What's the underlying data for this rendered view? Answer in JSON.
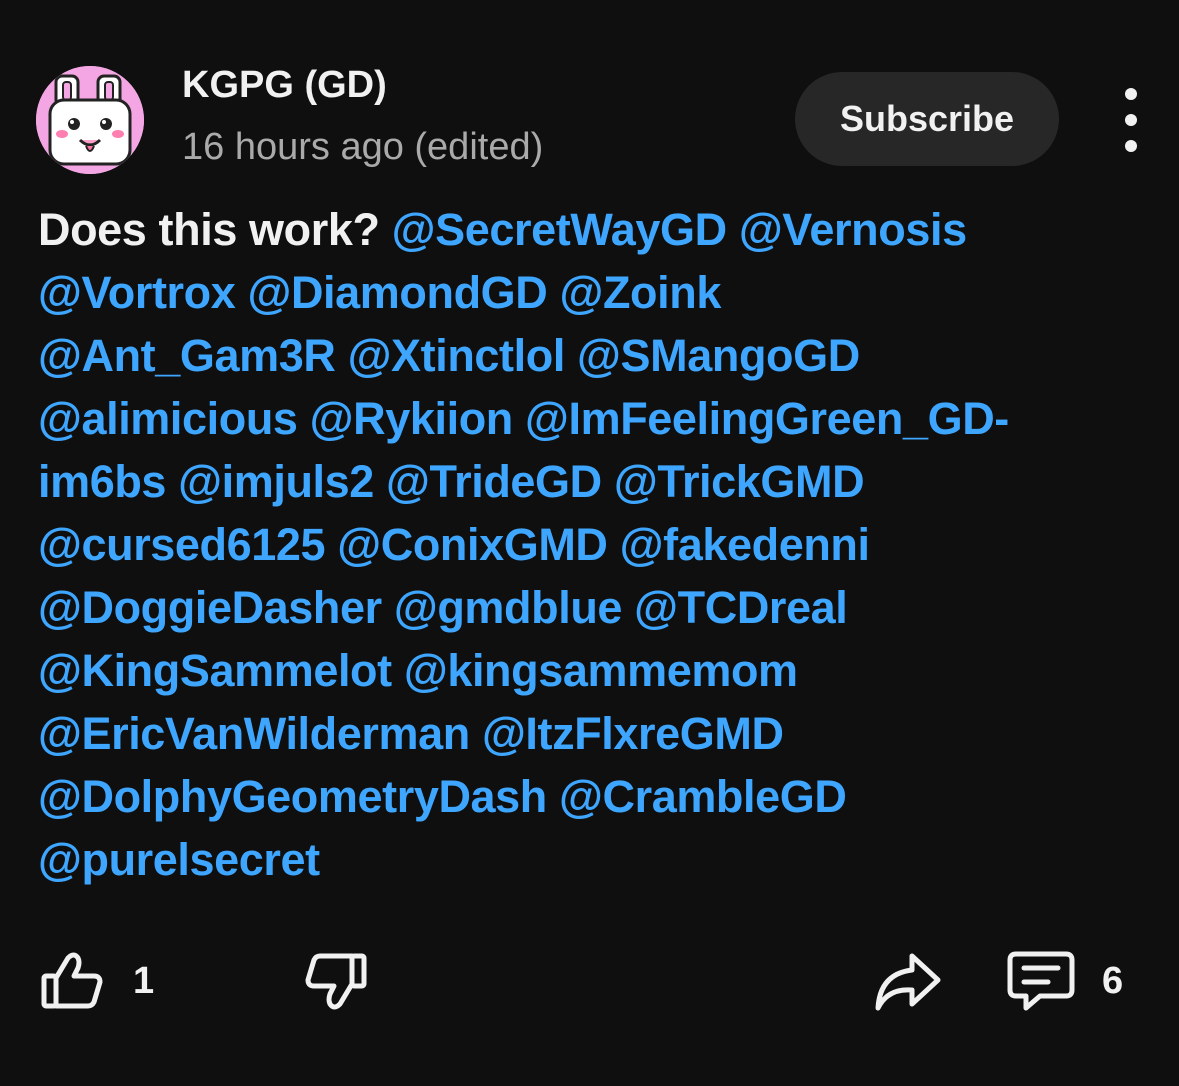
{
  "comment": {
    "author": "KGPG (GD)",
    "timestamp": "16 hours ago (edited)",
    "subscribe_label": "Subscribe",
    "lines": [
      [
        {
          "t": "Does this work? ",
          "mention": false
        },
        {
          "t": "@SecretWayGD",
          "mention": true
        },
        {
          "t": " ",
          "mention": false
        },
        {
          "t": "@Vernosis",
          "mention": true
        }
      ],
      [
        {
          "t": "@Vortrox",
          "mention": true
        },
        {
          "t": " ",
          "mention": false
        },
        {
          "t": "@DiamondGD",
          "mention": true
        },
        {
          "t": " ",
          "mention": false
        },
        {
          "t": "@Zoink",
          "mention": true
        }
      ],
      [
        {
          "t": "@Ant_Gam3R",
          "mention": true
        },
        {
          "t": " ",
          "mention": false
        },
        {
          "t": "@Xtinctlol",
          "mention": true
        },
        {
          "t": " ",
          "mention": false
        },
        {
          "t": "@SMangoGD",
          "mention": true
        }
      ],
      [
        {
          "t": "@alimicious",
          "mention": true
        },
        {
          "t": " ",
          "mention": false
        },
        {
          "t": "@Rykiion",
          "mention": true
        },
        {
          "t": " ",
          "mention": false
        },
        {
          "t": "@ImFeelingGreen_GD-",
          "mention": true
        }
      ],
      [
        {
          "t": "im6bs",
          "mention": true
        },
        {
          "t": " ",
          "mention": false
        },
        {
          "t": "@imjuls2",
          "mention": true
        },
        {
          "t": " ",
          "mention": false
        },
        {
          "t": "@TrideGD",
          "mention": true
        },
        {
          "t": " ",
          "mention": false
        },
        {
          "t": "@TrickGMD",
          "mention": true
        }
      ],
      [
        {
          "t": "@cursed6125",
          "mention": true
        },
        {
          "t": " ",
          "mention": false
        },
        {
          "t": "@ConixGMD",
          "mention": true
        },
        {
          "t": " ",
          "mention": false
        },
        {
          "t": "@fakedenni",
          "mention": true
        }
      ],
      [
        {
          "t": "@DoggieDasher",
          "mention": true
        },
        {
          "t": " ",
          "mention": false
        },
        {
          "t": "@gmdblue",
          "mention": true
        },
        {
          "t": " ",
          "mention": false
        },
        {
          "t": "@TCDreal",
          "mention": true
        }
      ],
      [
        {
          "t": "@KingSammelot",
          "mention": true
        },
        {
          "t": " ",
          "mention": false
        },
        {
          "t": "@kingsammemom",
          "mention": true
        }
      ],
      [
        {
          "t": "@EricVanWilderman",
          "mention": true
        },
        {
          "t": " ",
          "mention": false
        },
        {
          "t": "@ItzFlxreGMD",
          "mention": true
        }
      ],
      [
        {
          "t": "@DolphyGeometryDash",
          "mention": true
        },
        {
          "t": " ",
          "mention": false
        },
        {
          "t": "@CrambleGD",
          "mention": true
        }
      ],
      [
        {
          "t": "@purelsecret",
          "mention": true
        }
      ]
    ],
    "like_count": "1",
    "reply_count": "6"
  },
  "icons": {
    "like": "thumbs-up-icon",
    "dislike": "thumbs-down-icon",
    "share": "share-icon",
    "replies": "comment-icon",
    "more": "more-vert-icon"
  },
  "colors": {
    "background": "#0f0f0f",
    "text": "#f1f1f1",
    "secondary_text": "#aaaaaa",
    "mention": "#3ea6ff",
    "subscribe_bg": "#272727",
    "avatar_bg": "#f3a6e3"
  }
}
